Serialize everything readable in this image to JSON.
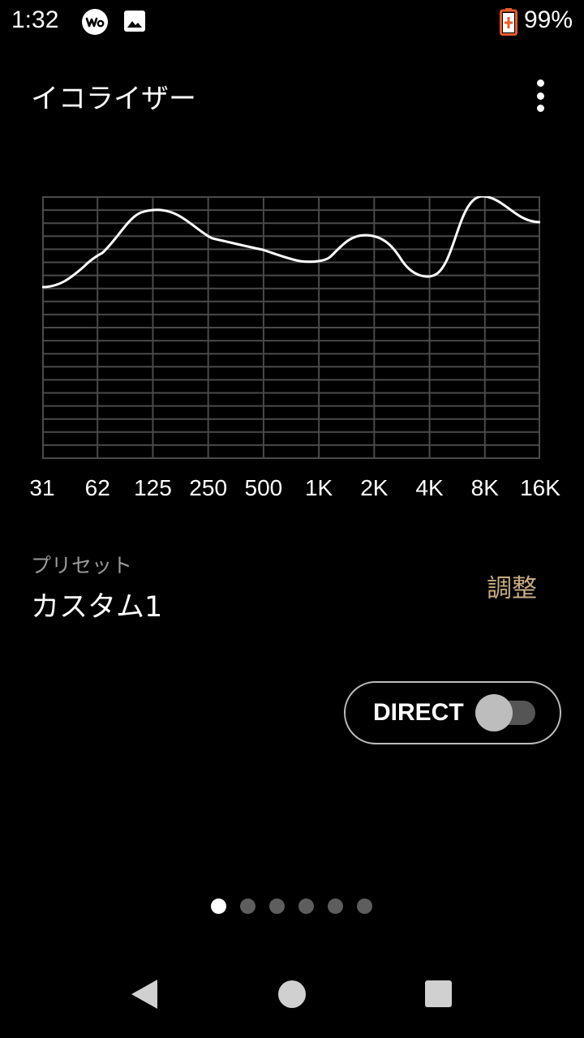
{
  "status_bar": {
    "time": "1:32",
    "battery": "99%",
    "icons": [
      "walkman-icon",
      "image-icon",
      "battery-charging-icon"
    ],
    "battery_color": "#e85c2c"
  },
  "header": {
    "title": "イコライザー",
    "menu_icon": "more-vert-icon"
  },
  "equalizer": {
    "bands": [
      "31",
      "62",
      "125",
      "250",
      "500",
      "1K",
      "2K",
      "4K",
      "8K",
      "16K"
    ],
    "horizontal_grid_lines": 21,
    "curve_color": "#ffffff",
    "grid_color": "#4a4a4a"
  },
  "preset": {
    "caption": "プリセット",
    "value": "カスタム1",
    "adjust_label": "調整",
    "adjust_color": "#c8ad82"
  },
  "direct": {
    "label": "DIRECT",
    "enabled": false
  },
  "pager": {
    "count": 6,
    "active_index": 0
  },
  "nav": {
    "icons": [
      "back-icon",
      "home-icon",
      "recents-icon"
    ]
  }
}
